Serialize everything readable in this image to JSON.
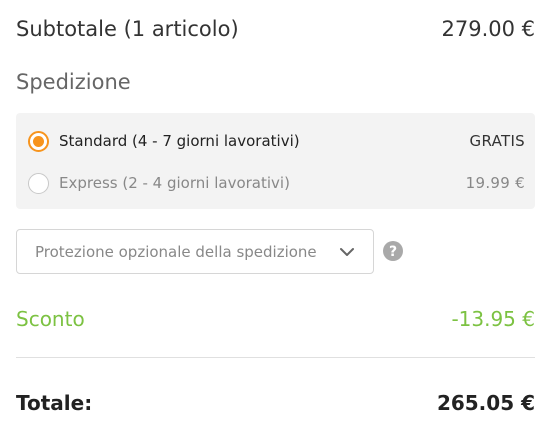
{
  "summary": {
    "subtotal_label": "Subtotale (1 articolo)",
    "subtotal_value": "279.00 €",
    "shipping_title": "Spedizione",
    "shipping_options": [
      {
        "label": "Standard (4 - 7 giorni lavorativi)",
        "price": "GRATIS",
        "selected": true
      },
      {
        "label": "Express (2 - 4 giorni lavorativi)",
        "price": "19.99 €",
        "selected": false
      }
    ],
    "protection_placeholder": "Protezione opzionale della spedizione",
    "discount_label": "Sconto",
    "discount_value": "-13.95 €",
    "total_label": "Totale:",
    "total_value": "265.05 €"
  },
  "icons": {
    "dropdown": "chevron-down-icon",
    "help": "question-circle-icon"
  },
  "colors": {
    "accent": "#f7941d",
    "discount": "#7cc242",
    "panel_bg": "#f3f3f3"
  }
}
